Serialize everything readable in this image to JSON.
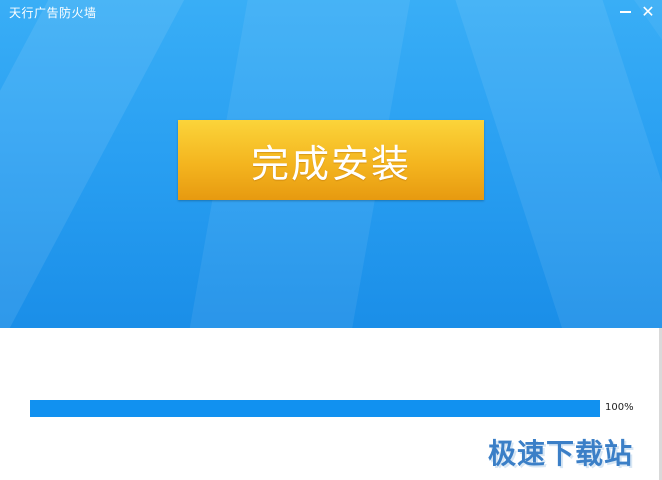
{
  "window": {
    "title": "天行广告防火墙",
    "minimize_label": "",
    "close_label": "✕"
  },
  "banner": {
    "finish_button_label": "完成安装"
  },
  "progress": {
    "percent": 100,
    "text": "100%"
  },
  "watermark": {
    "text": "极速下载站"
  },
  "colors": {
    "banner_blue": "#2aa0f2",
    "button_gold": "#f4b51f",
    "progress_blue": "#1191f0",
    "watermark_blue": "#3b7fc7"
  }
}
